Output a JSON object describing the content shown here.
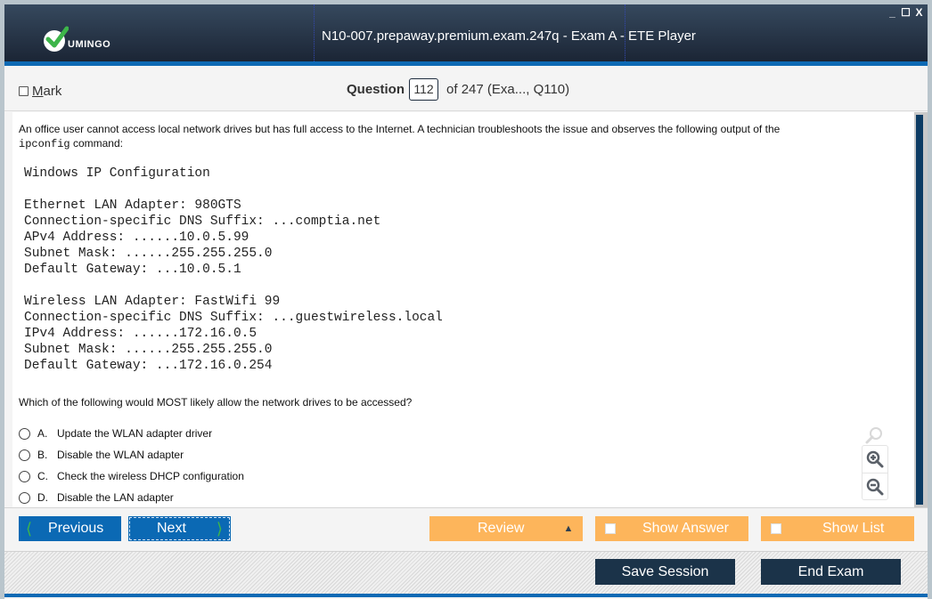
{
  "window": {
    "brand": "UMINGO",
    "title": "N10-007.prepaway.premium.exam.247q - Exam A - ETE Player",
    "controls": {
      "minimize": "_",
      "maximize": "☐",
      "close": "X"
    }
  },
  "question_bar": {
    "mark_label_first": "M",
    "mark_label_rest": "ark",
    "mark_checked": false,
    "question_label": "Question",
    "question_number": "112",
    "question_suffix": "of 247 (Exa..., Q110)"
  },
  "question": {
    "intro_before_code": "An office user cannot access local network drives but has full access to the Internet. A technician troubleshoots the issue and observes the following output of the",
    "intro_code": "ipconfig",
    "intro_after_code": " command:",
    "console_lines": [
      "Windows IP Configuration",
      "",
      "Ethernet LAN Adapter: 980GTS",
      "Connection-specific DNS Suffix: ...comptia.net",
      "APv4 Address: ......10.0.5.99",
      "Subnet Mask: ......255.255.255.0",
      "Default Gateway: ...10.0.5.1",
      "",
      "Wireless LAN Adapter: FastWifi 99",
      "Connection-specific DNS Suffix: ...guestwireless.local",
      "IPv4 Address: ......172.16.0.5",
      "Subnet Mask: ......255.255.255.0",
      "Default Gateway: ...172.16.0.254"
    ],
    "prompt": "Which of the following would MOST likely allow the network drives to be accessed?",
    "answers": [
      {
        "letter": "A.",
        "text": "Update the WLAN adapter driver"
      },
      {
        "letter": "B.",
        "text": "Disable the WLAN adapter"
      },
      {
        "letter": "C.",
        "text": "Check the wireless DHCP configuration"
      },
      {
        "letter": "D.",
        "text": "Disable the LAN adapter"
      }
    ]
  },
  "nav": {
    "previous": "Previous",
    "next": "Next",
    "review": "Review",
    "show_answer": "Show Answer",
    "show_list": "Show List"
  },
  "footer": {
    "save_session": "Save Session",
    "end_exam": "End Exam"
  },
  "colors": {
    "title_bg": "#1b2535",
    "accent_blue": "#0b69b4",
    "orange": "#fdb55b",
    "dark_button": "#1b3349",
    "check_green": "#3db54a"
  }
}
